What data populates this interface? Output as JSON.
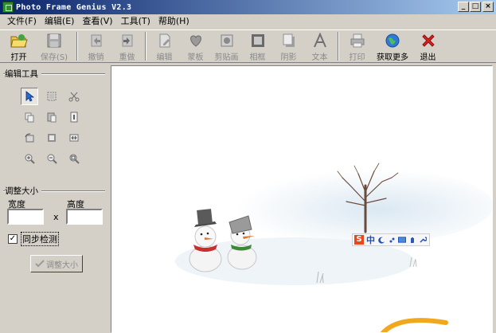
{
  "window": {
    "title": "Photo Frame Genius V2.3",
    "controls": {
      "minimize": "_",
      "maximize": "□",
      "close": "×"
    }
  },
  "menu": [
    {
      "label": "文件(F)"
    },
    {
      "label": "编辑(E)"
    },
    {
      "label": "查看(V)"
    },
    {
      "label": "工具(T)"
    },
    {
      "label": "帮助(H)"
    }
  ],
  "toolbar": {
    "open": "打开",
    "save": "保存(S)",
    "undo": "撤销",
    "redo": "重做",
    "edit": "编辑",
    "mask": "蒙板",
    "clip": "剪贴画",
    "frame": "相框",
    "shadow": "阴影",
    "text": "文本",
    "print": "打印",
    "more": "获取更多",
    "exit": "退出"
  },
  "left_panel": {
    "edit_tools_title": "编辑工具",
    "resize_title": "调整大小",
    "width_label": "宽度",
    "height_label": "高度",
    "width_value": "",
    "height_value": "",
    "times": "x",
    "sync_label": "同步检测",
    "sync_checked": "✓",
    "resize_button": "调整大小"
  },
  "ime": {
    "logo": "S",
    "mode": "中"
  },
  "colors": {
    "title_start": "#0a246a",
    "title_end": "#a6caf0",
    "face": "#d4d0c8",
    "canvas": "#ffffff"
  }
}
